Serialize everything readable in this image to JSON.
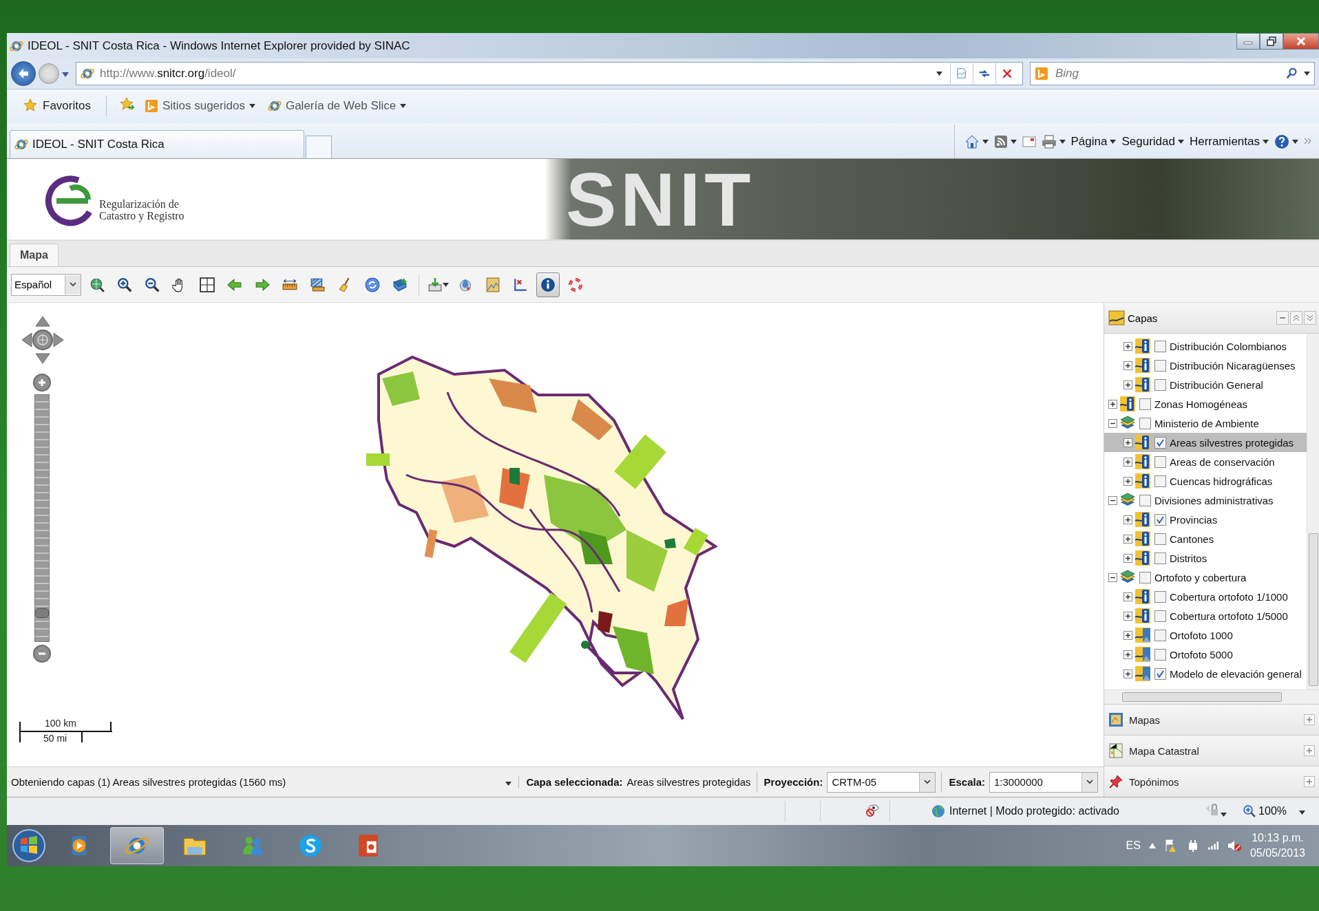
{
  "window": {
    "title": "IDEOL - SNIT Costa Rica - Windows Internet Explorer provided by SINAC"
  },
  "address_bar": {
    "url_prefix": "http://www.",
    "url_domain": "snitcr.org",
    "url_path": "/ideol/"
  },
  "search": {
    "placeholder": "Bing"
  },
  "favorites_bar": {
    "favorites": "Favoritos",
    "links": [
      "Sitios sugeridos",
      "Galería de Web Slice"
    ]
  },
  "browser_tabs": [
    {
      "label": "IDEOL - SNIT Costa Rica",
      "selected": true
    }
  ],
  "command_bar": {
    "menus": [
      "Página",
      "Seguridad",
      "Herramientas"
    ]
  },
  "banner": {
    "logo_lines": [
      "Regularización de",
      "Catastro y Registro"
    ],
    "background_title": "SNIT"
  },
  "app_tabs": [
    {
      "label": "Mapa",
      "selected": true
    }
  ],
  "toolbar": {
    "language": "Español",
    "tool_groups": [
      {
        "tools": [
          {
            "kind": "zoomextent",
            "selected": false
          },
          {
            "kind": "zoomin",
            "selected": false
          },
          {
            "kind": "zoomout",
            "selected": false
          },
          {
            "kind": "pan",
            "selected": false
          },
          {
            "kind": "box",
            "selected": false
          },
          {
            "kind": "back",
            "selected": false
          },
          {
            "kind": "forward",
            "selected": false
          },
          {
            "kind": "measure",
            "selected": false
          },
          {
            "kind": "area",
            "selected": false
          },
          {
            "kind": "clear",
            "selected": false
          },
          {
            "kind": "refresh",
            "selected": false
          },
          {
            "kind": "addlayer",
            "selected": false
          }
        ]
      },
      {
        "tools": [
          {
            "kind": "download",
            "selected": false
          },
          {
            "kind": "droplet",
            "selected": false
          },
          {
            "kind": "legend",
            "selected": false
          },
          {
            "kind": "axes",
            "selected": false
          },
          {
            "kind": "info",
            "selected": true
          },
          {
            "kind": "help",
            "selected": false
          }
        ]
      }
    ]
  },
  "map": {
    "zoom": {
      "level": 0.1
    },
    "scale": {
      "metric": "100 km",
      "imperial": "50 mi"
    }
  },
  "layers_panel": {
    "title": "Capas",
    "partial_children": [
      {
        "label": "Distribución Colombianos",
        "kind": "feature",
        "checked": false,
        "selected": false,
        "expanded": false
      },
      {
        "label": "Distribución Nicaragüenses",
        "kind": "feature",
        "checked": false,
        "selected": false,
        "expanded": false
      },
      {
        "label": "Distribución General",
        "kind": "feature",
        "checked": false,
        "selected": false,
        "expanded": false
      }
    ],
    "tree": [
      {
        "label": "Zonas Homogéneas",
        "kind": "feature",
        "checked": false,
        "selected": false,
        "expanded": false
      },
      {
        "label": "Ministerio de Ambiente",
        "kind": "group",
        "checked": false,
        "selected": false,
        "expanded": true,
        "children": [
          {
            "label": "Areas silvestres protegidas",
            "kind": "feature",
            "checked": true,
            "selected": true,
            "expanded": false
          },
          {
            "label": "Areas de conservación",
            "kind": "feature",
            "checked": false,
            "selected": false,
            "expanded": false
          },
          {
            "label": "Cuencas hidrográficas",
            "kind": "feature",
            "checked": false,
            "selected": false,
            "expanded": false
          }
        ]
      },
      {
        "label": "Divisiones administrativas",
        "kind": "group",
        "checked": false,
        "selected": false,
        "expanded": true,
        "children": [
          {
            "label": "Provincias",
            "kind": "feature",
            "checked": true,
            "selected": false,
            "expanded": false
          },
          {
            "label": "Cantones",
            "kind": "feature",
            "checked": false,
            "selected": false,
            "expanded": false
          },
          {
            "label": "Distritos",
            "kind": "feature",
            "checked": false,
            "selected": false,
            "expanded": false
          }
        ]
      },
      {
        "label": "Ortofoto y cobertura",
        "kind": "group",
        "checked": false,
        "selected": false,
        "expanded": true,
        "children": [
          {
            "label": "Cobertura ortofoto 1/1000",
            "kind": "feature",
            "checked": false,
            "selected": false,
            "expanded": false
          },
          {
            "label": "Cobertura ortofoto 1/5000",
            "kind": "feature",
            "checked": false,
            "selected": false,
            "expanded": false
          },
          {
            "label": "Ortofoto 1000",
            "kind": "raster",
            "checked": false,
            "selected": false,
            "expanded": false
          },
          {
            "label": "Ortofoto 5000",
            "kind": "raster",
            "checked": false,
            "selected": false,
            "expanded": false
          },
          {
            "label": "Modelo de elevación general",
            "kind": "raster",
            "checked": true,
            "selected": false,
            "expanded": false
          }
        ]
      }
    ]
  },
  "accordion": [
    {
      "label": "Mapas",
      "kind": "maps",
      "expanded": false
    },
    {
      "label": "Mapa Catastral",
      "kind": "cadastre",
      "expanded": false
    },
    {
      "label": "Topónimos",
      "kind": "placenames",
      "expanded": false
    }
  ],
  "status_row": {
    "message": "Obteniendo capas (1)  Areas silvestres protegidas (1560 ms)",
    "selected_layer": "**Capa seleccionada:** Areas silvestres protegidas",
    "projection_label": "Proyección:",
    "projection": "CRTM-05",
    "scale_label": "Escala:",
    "scale": "1:3000000"
  },
  "ie_status": {
    "zone": "Internet | Modo protegido: activado",
    "zoom": "100%"
  },
  "taskbar": {
    "apps": [
      {
        "kind": "media",
        "selected": false
      },
      {
        "kind": "browser",
        "selected": true
      },
      {
        "kind": "folder",
        "selected": false
      },
      {
        "kind": "people",
        "selected": false
      },
      {
        "kind": "chat",
        "selected": false
      },
      {
        "kind": "slides",
        "selected": false
      }
    ],
    "language": "ES",
    "time": "10:13 p.m.",
    "date": "05/05/2013"
  }
}
